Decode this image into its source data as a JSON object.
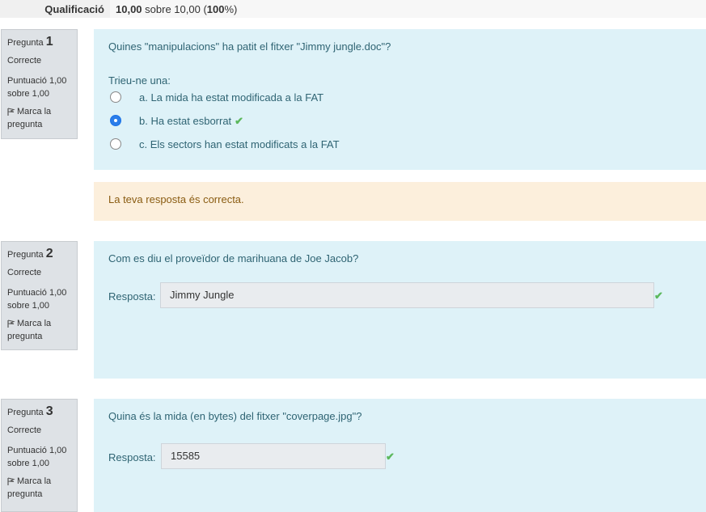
{
  "summary": {
    "label": "Qualificació",
    "score": "10,00",
    "sobre": "sobre 10,00 (",
    "percent": "100",
    "percent_suffix": "%)"
  },
  "questions": [
    {
      "prefix": "Pregunta",
      "number": "1",
      "state": "Correcte",
      "grade": "Puntuació 1,00 sobre 1,00",
      "flag": "Marca la pregunta",
      "text": "Quines \"manipulacions\" ha patit el fitxer \"Jimmy jungle.doc\"?",
      "prompt": "Trieu-ne una:",
      "options": [
        {
          "label": "a. La mida ha estat modificada a la FAT",
          "selected": false
        },
        {
          "label": "b. Ha estat esborrat",
          "selected": true
        },
        {
          "label": "c. Els sectors han estat modificats a la FAT",
          "selected": false
        }
      ],
      "feedback": "La teva resposta és correcta."
    },
    {
      "prefix": "Pregunta",
      "number": "2",
      "state": "Correcte",
      "grade": "Puntuació 1,00 sobre 1,00",
      "flag": "Marca la pregunta",
      "text": "Com es diu el proveïdor de marihuana de Joe Jacob?",
      "answer_label": "Resposta:",
      "answer": "Jimmy Jungle"
    },
    {
      "prefix": "Pregunta",
      "number": "3",
      "state": "Correcte",
      "grade": "Puntuació 1,00 sobre 1,00",
      "flag": "Marca la pregunta",
      "text": "Quina és la mida (en bytes) del fitxer \"coverpage.jpg\"?",
      "answer_label": "Resposta:",
      "answer": "15585"
    }
  ],
  "icons": {
    "check": "✔",
    "flag": "flag-icon"
  },
  "colors": {
    "content_bg": "#def2f8",
    "feedback_bg": "#fcefdc",
    "correct": "#5cb85c",
    "radio_selected": "#2b7de9"
  }
}
